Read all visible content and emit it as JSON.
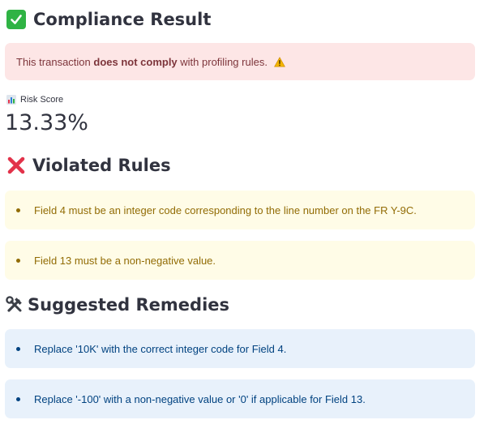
{
  "compliance": {
    "title": "Compliance Result",
    "message_prefix": "This transaction ",
    "message_bold": "does not comply",
    "message_suffix": " with profiling rules."
  },
  "metric": {
    "label": "Risk Score",
    "value": "13.33%"
  },
  "violated": {
    "title": "Violated Rules",
    "items": [
      "Field 4 must be an integer code corresponding to the line number on the FR Y-9C.",
      "Field 13 must be a non-negative value."
    ]
  },
  "remedies": {
    "title": "Suggested Remedies",
    "items": [
      "Replace '10K' with the correct integer code for Field 4.",
      "Replace '-100' with a non-negative value or '0' if applicable for Field 13."
    ]
  },
  "colors": {
    "success_check": "#2fb344",
    "error_bg": "#fde6e6",
    "error_text": "#7d353b",
    "warning_bg": "#fffce7",
    "warning_text": "#926c05",
    "info_bg": "#e8f1fb",
    "info_text": "#004280",
    "cross": "#e2324a"
  },
  "icons": {
    "compliance": "check-mark-button-icon",
    "warning": "warning-icon",
    "metric": "bar-chart-icon",
    "violated": "cross-mark-icon",
    "remedies": "hammer-wrench-icon"
  }
}
